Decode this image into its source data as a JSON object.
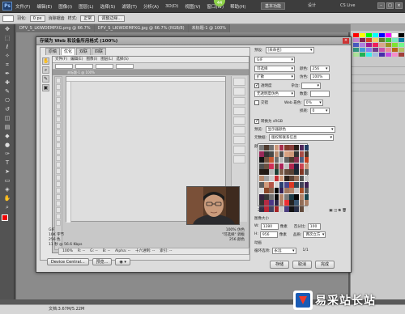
{
  "menubar": {
    "logo": "Ps",
    "items": [
      "文件(F)",
      "编辑(E)",
      "图像(I)",
      "图层(L)",
      "选择(S)",
      "滤镜(T)",
      "分析(A)",
      "3D(D)",
      "视图(V)",
      "窗口(W)",
      "帮助(H)"
    ],
    "badge": "44",
    "workspace": "基本功能",
    "workspace2": "设计",
    "cslive": "CS Live",
    "win_buttons": [
      "–",
      "□",
      "×"
    ]
  },
  "optbar": {
    "feather_label": "羽化:",
    "feather_value": "0 px",
    "antialias_label": "消除锯齿",
    "style_label": "样式:",
    "style_value": "正常",
    "refine_label": "调整边缘..."
  },
  "doctabs": [
    "DFV_S_LKIWDEMPXG.png @ 66.7%",
    "DFV_S_LKIWDEMPXG.jpg @ 66.7% (RGB/8)",
    "未标题-1 @ 100%"
  ],
  "dialog": {
    "title": "存储为 Web 和设备所用格式 (100%)",
    "close": "×",
    "tabs": [
      "原稿",
      "优化",
      "双联",
      "四联"
    ],
    "tools": [
      "✋",
      "⌕",
      "✎",
      "▣"
    ],
    "preview_left": [
      "GIF",
      "10K 字节",
      "256 色",
      "11 秒 @ 56.6 Kbps"
    ],
    "preview_right": [
      "100% 仿色",
      "\"可选择\" 调板",
      "256 颜色"
    ],
    "status": {
      "zoom": "100%",
      "r": "R: --",
      "g": "G: --",
      "b": "B: --",
      "alpha": "Alpha: --",
      "hex": "十六进制: --",
      "index": "索引: --"
    },
    "buttons": {
      "device_central": "Device Central...",
      "preview": "预览...",
      "save": "存储",
      "cancel": "取消",
      "done": "完成"
    }
  },
  "settings": {
    "preset_label": "预设:",
    "preset_value": "[未命名]",
    "format": "GIF",
    "reduction": "可选择",
    "dither_algo": "扩散",
    "colors_label": "颜色:",
    "colors_value": "256",
    "dither_label": "仿色:",
    "dither_value": "100%",
    "transparency_label": "透明度",
    "transparency_checked": true,
    "matte_label": "杂边:",
    "transparency_dither": "无透明度仿色",
    "amount_label": "数量:",
    "interlaced_label": "交错",
    "interlaced_checked": false,
    "webSnap_label": "Web 靠色:",
    "webSnap_value": "0%",
    "lossy_label": "损耗:",
    "lossy_value": "0",
    "convert_label": "转换为 sRGB",
    "convert_checked": true,
    "preview_label": "预览:",
    "preview_value": "显示器颜色",
    "metadata_label": "元数据:",
    "metadata_value": "版权和联系信息",
    "color_table_label": "颜色表",
    "color_count": "256",
    "image_size_label": "图像大小",
    "w_label": "W:",
    "w_value": "1280",
    "px1": "像素",
    "pct_label": "百分比:",
    "pct_value": "100",
    "h_label": "H:",
    "h_value": "956",
    "px2": "像素",
    "quality_label": "品质:",
    "quality_value": "两次立方",
    "anim_label": "动画",
    "loop_label": "循环选项:",
    "loop_value": "永远",
    "frame_counter": "1/1"
  },
  "status_bar": "文档:3.67M/5.22M",
  "watermark": "易采站长站"
}
